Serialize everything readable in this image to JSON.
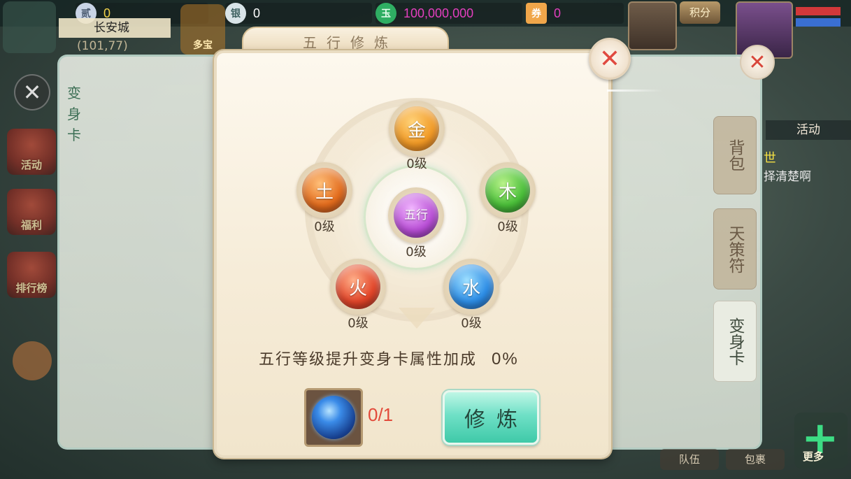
{
  "topbar": {
    "resources": [
      {
        "icon": "ingot-coin-icon",
        "glyph": "贰",
        "value": "0"
      },
      {
        "icon": "silver-ingot-icon",
        "glyph": "银",
        "value": "0"
      },
      {
        "icon": "jade-coin-icon",
        "glyph": "玉",
        "value": "100,000,000"
      },
      {
        "icon": "ticket-icon",
        "glyph": "券",
        "value": "0"
      }
    ],
    "city_name": "长安城",
    "city_coords": "(101,77)",
    "points_label": "积分"
  },
  "sidebar": {
    "items": [
      {
        "label": "活动"
      },
      {
        "label": "福利"
      },
      {
        "label": "排行榜"
      }
    ],
    "shop_label": "多宝"
  },
  "card_window": {
    "title": "变身卡",
    "tabs": [
      {
        "label": "背包"
      },
      {
        "label": "天策符"
      },
      {
        "label": "变身卡"
      }
    ]
  },
  "activity": {
    "header": "活动",
    "line1": "世",
    "line2": "择清楚啊"
  },
  "bottom_tabs": [
    "队伍",
    "包裹"
  ],
  "more_label": "更多",
  "wuxing": {
    "title": "五行修炼",
    "elements": [
      {
        "key": "metal",
        "glyph": "金",
        "level": "0级",
        "color": "#f19a26"
      },
      {
        "key": "wood",
        "glyph": "木",
        "level": "0级",
        "color": "#4bbf3a"
      },
      {
        "key": "water",
        "glyph": "水",
        "level": "0级",
        "color": "#2e8ee6"
      },
      {
        "key": "fire",
        "glyph": "火",
        "level": "0级",
        "color": "#e2462a"
      },
      {
        "key": "earth",
        "glyph": "土",
        "level": "0级",
        "color": "#e36d1e"
      },
      {
        "key": "center",
        "glyph": "五行",
        "level": "0级",
        "color": "#b94fd6"
      }
    ],
    "bonus_text": "五行等级提升变身卡属性加成",
    "bonus_value": "0%",
    "item_count": "0/1",
    "train_button": "修炼"
  }
}
